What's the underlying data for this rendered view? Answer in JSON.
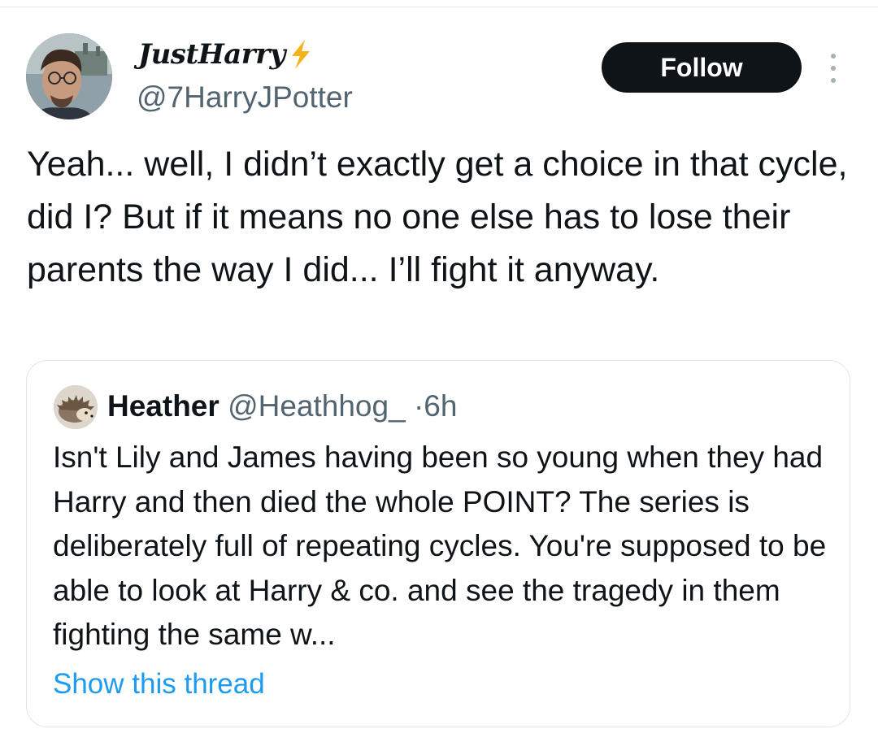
{
  "tweet": {
    "author": {
      "display_name": "JustHarry",
      "name_emoji_icon": "lightning-bolt-icon",
      "handle": "@7HarryJPotter",
      "avatar_icon": "user-avatar-photo"
    },
    "follow_label": "Follow",
    "more_icon": "more-options-icon",
    "text": "Yeah... well, I didn’t exactly get a choice in that cycle, did I? But if it means no one else has to lose their parents the way I did... I’ll fight it anyway."
  },
  "quote": {
    "author": {
      "display_name": "Heather",
      "handle": "@Heathhog_",
      "separator": "·",
      "time": "6h",
      "avatar_icon": "hedgehog-avatar"
    },
    "text": "Isn't Lily and James having been so young when they had Harry and then died the whole POINT? The series is deliberately full of repeating cycles. You're supposed to be able to look at Harry & co. and see the tragedy in them fighting the same w...",
    "show_thread_label": "Show this thread"
  },
  "colors": {
    "text_primary": "#0f1419",
    "text_secondary": "#536471",
    "link": "#1d9bf0",
    "button_bg": "#0f1419",
    "border": "#dfe5ea",
    "bolt": "#f5b21a"
  }
}
